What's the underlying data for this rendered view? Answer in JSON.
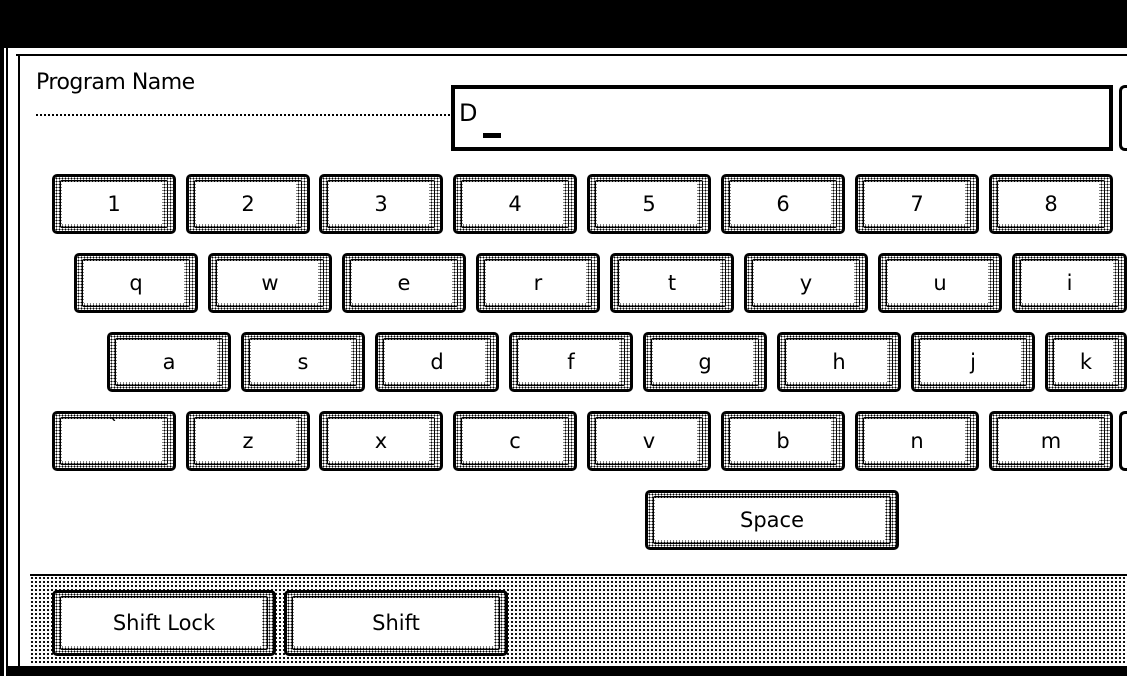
{
  "form": {
    "label": "Program Name",
    "value": "D"
  },
  "keyboard": {
    "row1": [
      "1",
      "2",
      "3",
      "4",
      "5",
      "6",
      "7",
      "8"
    ],
    "row2": [
      "q",
      "w",
      "e",
      "r",
      "t",
      "y",
      "u",
      "i"
    ],
    "row3": [
      "a",
      "s",
      "d",
      "f",
      "g",
      "h",
      "j",
      "k"
    ],
    "row4": [
      "`",
      "z",
      "x",
      "c",
      "v",
      "b",
      "n",
      "m"
    ],
    "space": "Space"
  },
  "modifiers": {
    "shift_lock": "Shift Lock",
    "shift": "Shift"
  }
}
